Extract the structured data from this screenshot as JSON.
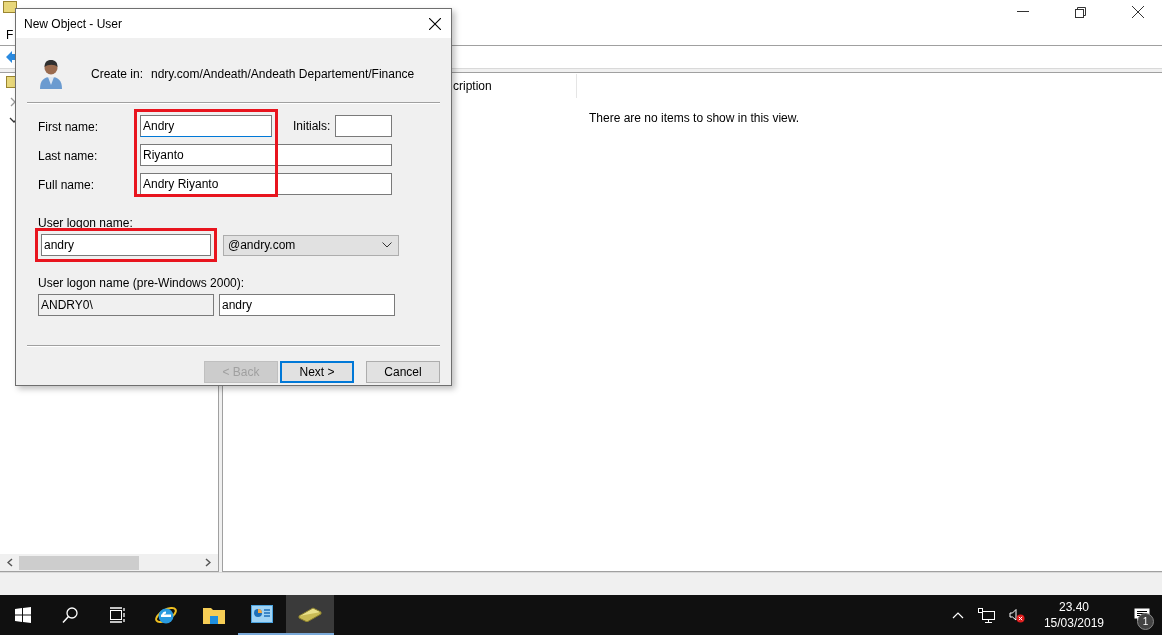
{
  "window": {
    "menu": [
      {
        "label": "F"
      }
    ],
    "list": {
      "columns": [
        "cription"
      ],
      "empty_message": "There are no items to show in this view."
    }
  },
  "dialog": {
    "title": "New Object - User",
    "create_in": {
      "label": "Create in:",
      "path": "ndry.com/Andeath/Andeath Departement/Finance"
    },
    "name_fields": {
      "highlighted": true,
      "first_name": {
        "label": "First name:",
        "value": "Andry",
        "focused": true
      },
      "initials": {
        "label": "Initials:"
      },
      "last_name": {
        "label": "Last name:",
        "value": "Riyanto"
      },
      "full_name": {
        "label": "Full name:",
        "value": "Andry Riyanto"
      }
    },
    "logon": {
      "label": "User logon name:",
      "value": "andry",
      "highlighted": true,
      "domain": "@andry.com"
    },
    "pre_windows": {
      "label": "User logon name (pre-Windows 2000):",
      "domain": "ANDRY0\\",
      "value": "andry"
    },
    "buttons": [
      {
        "label": "< Back",
        "disabled": true,
        "default": false
      },
      {
        "label": "Next >",
        "disabled": false,
        "default": true
      },
      {
        "label": "Cancel",
        "disabled": false,
        "default": false
      }
    ]
  },
  "taskbar": {
    "apps": [
      {
        "kind": "start",
        "running": false,
        "active": false
      },
      {
        "kind": "search",
        "running": false,
        "active": false
      },
      {
        "kind": "taskview",
        "running": false,
        "active": false
      },
      {
        "kind": "browser",
        "running": false,
        "active": false
      },
      {
        "kind": "folder",
        "running": false,
        "active": false
      },
      {
        "kind": "console",
        "running": true,
        "active": false
      },
      {
        "kind": "directory",
        "running": true,
        "active": true
      }
    ],
    "clock": {
      "time": "23.40",
      "date": "15/03/2019"
    },
    "notifications": "1"
  }
}
